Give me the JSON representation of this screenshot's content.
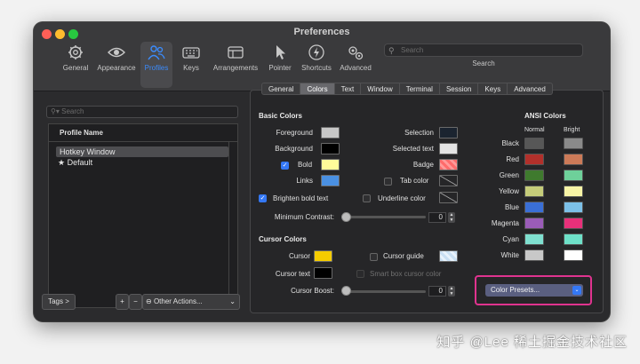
{
  "window": {
    "title": "Preferences"
  },
  "toolbar": {
    "items": [
      {
        "label": "General",
        "icon": "gear-icon"
      },
      {
        "label": "Appearance",
        "icon": "eye-icon"
      },
      {
        "label": "Profiles",
        "icon": "people-icon",
        "selected": true
      },
      {
        "label": "Keys",
        "icon": "keyboard-icon"
      },
      {
        "label": "Arrangements",
        "icon": "windows-icon"
      },
      {
        "label": "Pointer",
        "icon": "pointer-icon"
      },
      {
        "label": "Shortcuts",
        "icon": "bolt-icon"
      },
      {
        "label": "Advanced",
        "icon": "gears-icon"
      }
    ],
    "search_placeholder": "Search",
    "search_label": "Search"
  },
  "sidebar": {
    "search_placeholder": "Search",
    "list_header": "Profile Name",
    "profiles": [
      {
        "name": "Hotkey Window",
        "selected": true
      },
      {
        "name": "★ Default",
        "selected": false
      }
    ],
    "tags_button": "Tags >",
    "add_button": "+",
    "remove_button": "−",
    "other_actions": "Other Actions...",
    "other_actions_icon": "gear-icon"
  },
  "tabs": [
    "General",
    "Colors",
    "Text",
    "Window",
    "Terminal",
    "Session",
    "Keys",
    "Advanced"
  ],
  "selected_tab": "Colors",
  "basic_colors": {
    "title": "Basic Colors",
    "foreground": {
      "label": "Foreground",
      "color": "#c7c7c7"
    },
    "background": {
      "label": "Background",
      "color": "#000000"
    },
    "bold": {
      "label": "Bold",
      "color": "#fffb9a",
      "checked": true
    },
    "links": {
      "label": "Links",
      "color": "#4a90e2"
    },
    "selection": {
      "label": "Selection",
      "color": "#1b2430"
    },
    "selected_text": {
      "label": "Selected text",
      "color": "#e4e4e4"
    },
    "badge": {
      "label": "Badge",
      "color": "#ff6b6b"
    },
    "tab_color": {
      "label": "Tab color",
      "checked": false
    },
    "brighten_bold": {
      "label": "Brighten bold text",
      "checked": true
    },
    "underline_color": {
      "label": "Underline color",
      "checked": false
    },
    "min_contrast": {
      "label": "Minimum Contrast:",
      "value": "0"
    }
  },
  "cursor_colors": {
    "title": "Cursor Colors",
    "cursor": {
      "label": "Cursor",
      "color": "#f5cc00"
    },
    "cursor_text": {
      "label": "Cursor text",
      "color": "#000000"
    },
    "cursor_guide": {
      "label": "Cursor guide",
      "color": "#c9dff2",
      "checked": false
    },
    "smart_box": {
      "label": "Smart box cursor color"
    },
    "cursor_boost": {
      "label": "Cursor Boost:",
      "value": "0"
    }
  },
  "ansi": {
    "title": "ANSI Colors",
    "normal_label": "Normal",
    "bright_label": "Bright",
    "rows": [
      {
        "name": "Black",
        "normal": "#575757",
        "bright": "#8a8a8a"
      },
      {
        "name": "Red",
        "normal": "#b2302b",
        "bright": "#cc7a58"
      },
      {
        "name": "Green",
        "normal": "#3f7a2e",
        "bright": "#6ed09a"
      },
      {
        "name": "Yellow",
        "normal": "#c5cc7a",
        "bright": "#f7f4a6"
      },
      {
        "name": "Blue",
        "normal": "#3a6fd6",
        "bright": "#7cc0e8"
      },
      {
        "name": "Magenta",
        "normal": "#9a5cb8",
        "bright": "#e8307a"
      },
      {
        "name": "Cyan",
        "normal": "#7fe0d0",
        "bright": "#6ee0c8"
      },
      {
        "name": "White",
        "normal": "#c8c8c8",
        "bright": "#ffffff"
      }
    ]
  },
  "presets": {
    "label": "Color Presets..."
  },
  "watermark": "知乎 @Lee 稀土掘金技术社区"
}
